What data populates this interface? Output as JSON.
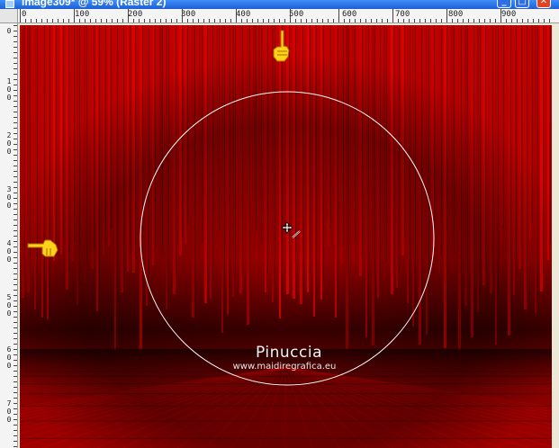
{
  "window": {
    "title": "Image309* @ 59% (Raster 2)",
    "minimize_glyph": "_",
    "maximize_glyph": "□",
    "close_glyph": "✕"
  },
  "ruler_top": {
    "labels": [
      "0",
      "100",
      "200",
      "300",
      "400",
      "500",
      "600",
      "700",
      "800",
      "900"
    ]
  },
  "ruler_left": {
    "labels": [
      "0",
      "100",
      "200",
      "300",
      "400",
      "500",
      "600",
      "700"
    ]
  },
  "watermark": {
    "name": "Pinuccia",
    "url": "www.maidiregrafica.eu"
  },
  "colors": {
    "background_red": "#c00000",
    "dark_red": "#3a0000",
    "selection_circle": "#ffffff",
    "hand_pointer": "#ffd21a"
  },
  "icons": {
    "pointer_top": "hand-pointing-down-icon",
    "pointer_left": "hand-pointing-right-icon",
    "cursor": "move-selection-cursor-icon"
  }
}
